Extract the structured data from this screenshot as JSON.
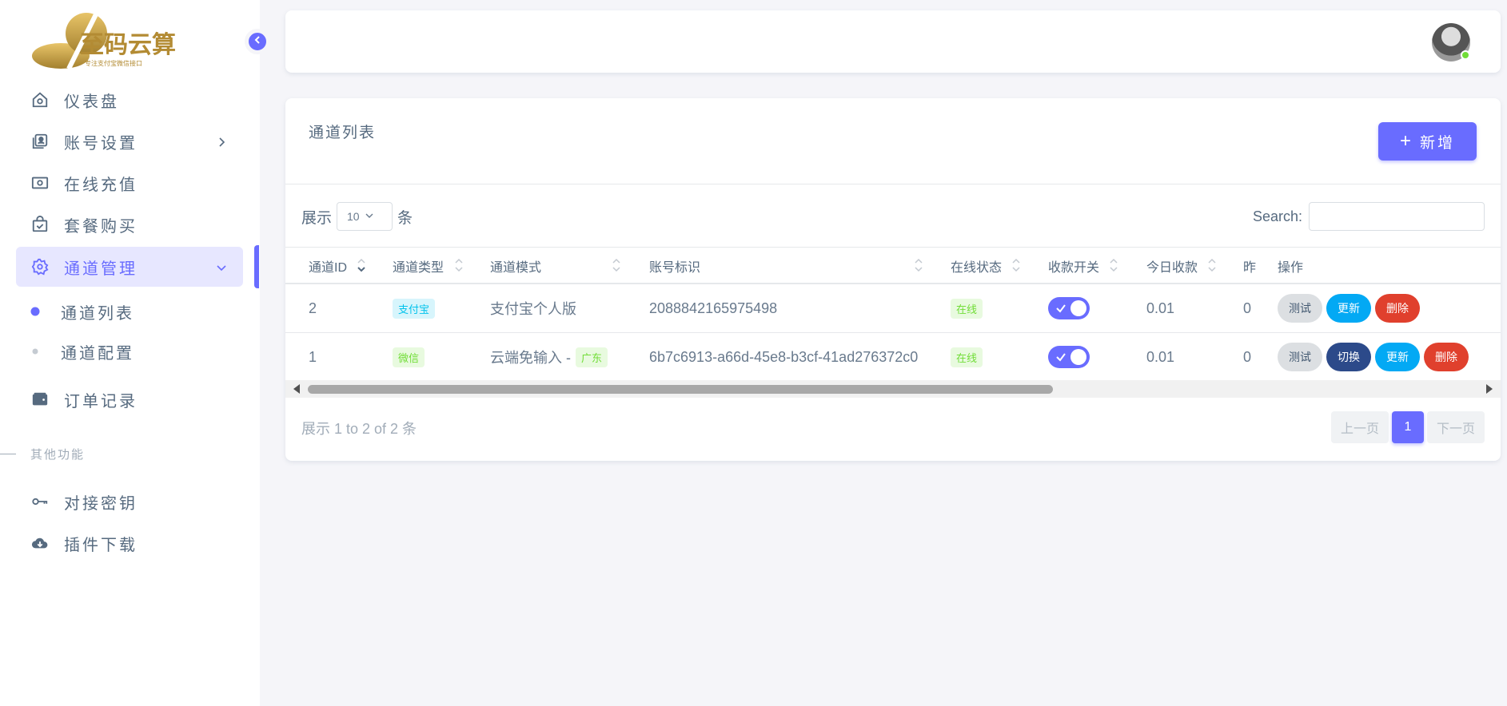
{
  "brand": {
    "logo_text": "至码云算",
    "logo_subtitle": "专注支付宝微信接口"
  },
  "sidebar": {
    "items": [
      {
        "label": "仪表盘"
      },
      {
        "label": "账号设置"
      },
      {
        "label": "在线充值"
      },
      {
        "label": "套餐购买"
      },
      {
        "label": "通道管理"
      },
      {
        "label": "订单记录"
      }
    ],
    "subitems": [
      {
        "label": "通道列表"
      },
      {
        "label": "通道配置"
      }
    ],
    "section_label": "其他功能",
    "extra_items": [
      {
        "label": "对接密钥"
      },
      {
        "label": "插件下载"
      }
    ]
  },
  "card": {
    "title": "通道列表",
    "add_label": "新增",
    "show_prefix": "展示",
    "page_length": "10",
    "show_suffix": "条",
    "search_label": "Search:",
    "headers": [
      "通道ID",
      "通道类型",
      "通道模式",
      "账号标识",
      "在线状态",
      "收款开关",
      "今日收款",
      "昨",
      "操作"
    ],
    "rows": [
      {
        "id": "2",
        "type": "支付宝",
        "mode": "支付宝个人版",
        "mode_tag": "",
        "account": "2088842165975498",
        "status": "在线",
        "switch_on": true,
        "today": "0.01",
        "yesterday": "0",
        "actions": [
          "测试",
          "更新",
          "删除"
        ]
      },
      {
        "id": "1",
        "type": "微信",
        "mode": "云端免输入 -",
        "mode_tag": "广东",
        "account": "6b7c6913-a66d-45e8-b3cf-41ad276372c0",
        "status": "在线",
        "switch_on": true,
        "today": "0.01",
        "yesterday": "0",
        "actions": [
          "测试",
          "切换",
          "更新",
          "删除"
        ]
      }
    ],
    "info_text": "展示 1 to 2 of 2 条",
    "pager": {
      "prev": "上一页",
      "current": "1",
      "next": "下一页"
    }
  },
  "colors": {
    "primary": "#696cff",
    "cyan": "#03c3ec",
    "green": "#71dd37",
    "red": "#e0402d",
    "blue": "#03a9f4",
    "navy": "#2c4a8a"
  }
}
